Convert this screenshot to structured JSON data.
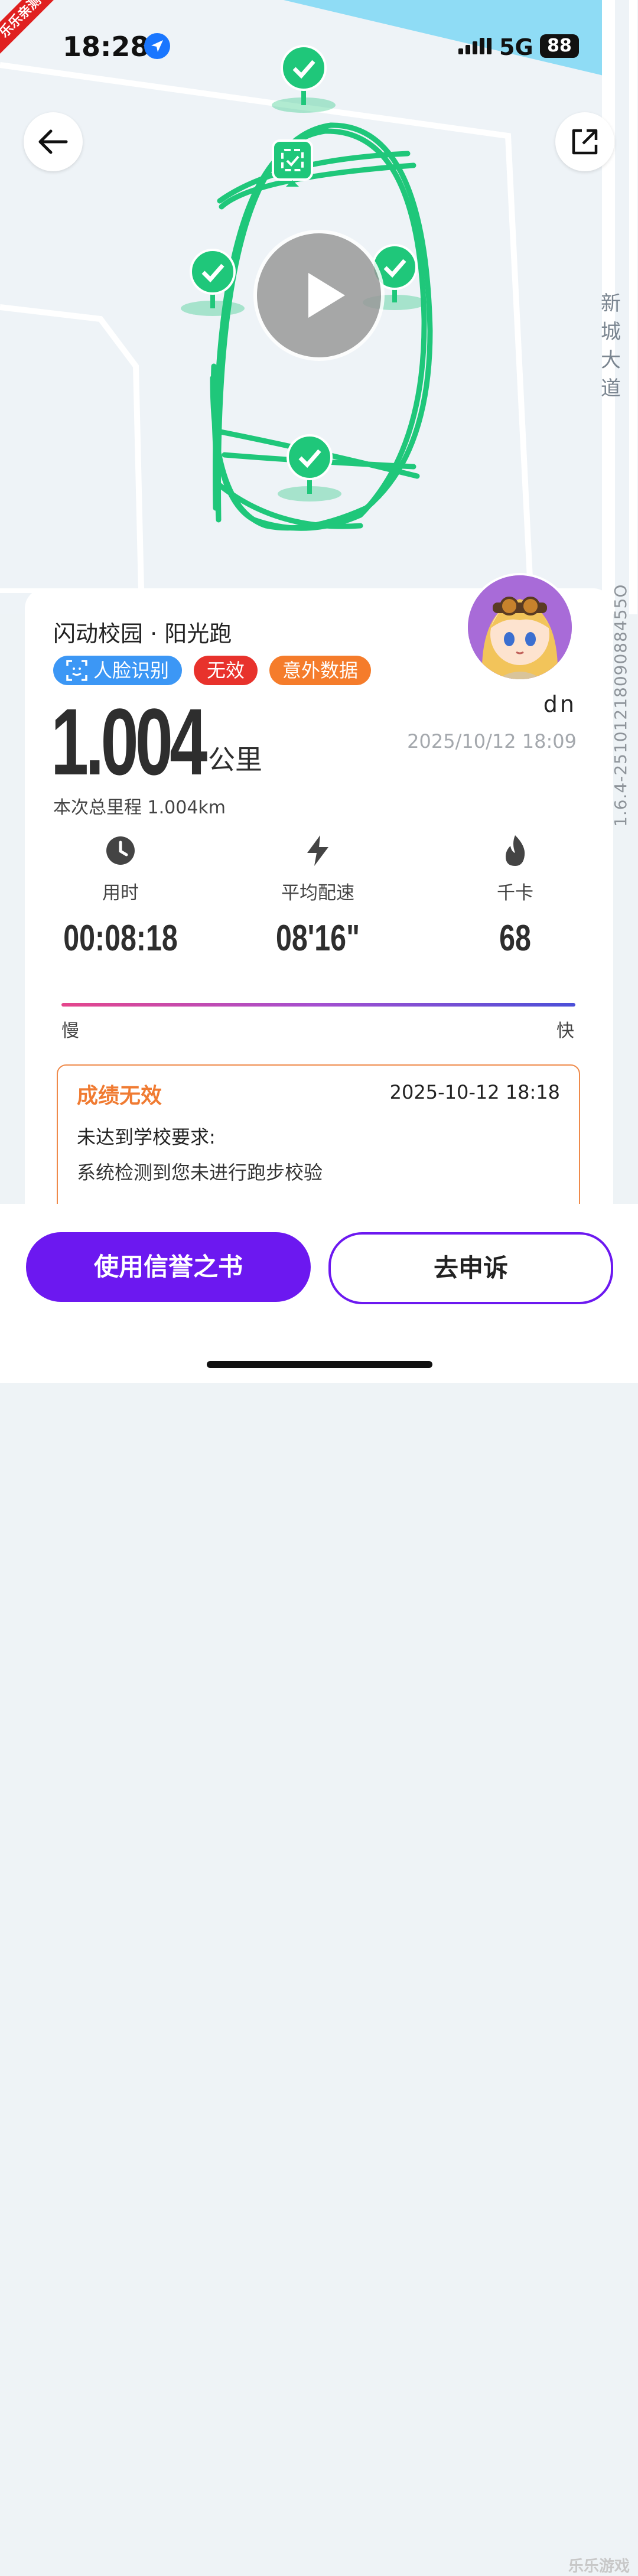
{
  "status_bar": {
    "time": "18:28",
    "network": "5G",
    "battery": "88"
  },
  "corner_badge": "乐乐亲测",
  "map": {
    "road_label": "新城大道"
  },
  "version_text": "1.6.4-2510121809088455O",
  "card": {
    "title": "闪动校园 · 阳光跑",
    "tags": {
      "face": "人脸识别",
      "invalid": "无效",
      "abnormal": "意外数据"
    },
    "username": "dn",
    "datetime": "2025/10/12 18:09",
    "distance": "1.004",
    "unit": "公里",
    "total": "本次总里程 1.004km",
    "stats": {
      "duration": {
        "label": "用时",
        "value": "00:08:18",
        "icon": "clock-icon"
      },
      "pace": {
        "label": "平均配速",
        "value": "08'16\"",
        "icon": "lightning-icon"
      },
      "calories": {
        "label": "千卡",
        "value": "68",
        "icon": "flame-icon"
      }
    },
    "speed": {
      "slow": "慢",
      "fast": "快"
    },
    "result": {
      "title": "成绩无效",
      "time": "2025-10-12 18:18",
      "reason_title": "未达到学校要求:",
      "reason_text": "系统检测到您未进行跑步校验"
    }
  },
  "buttons": {
    "use_credit": "使用信誉之书",
    "appeal": "去申诉"
  },
  "watermark": "乐乐游戏",
  "colors": {
    "route": "#1fc77a",
    "accent": "#6c18f0",
    "invalid": "#e8322c",
    "warning": "#f57c2b"
  }
}
